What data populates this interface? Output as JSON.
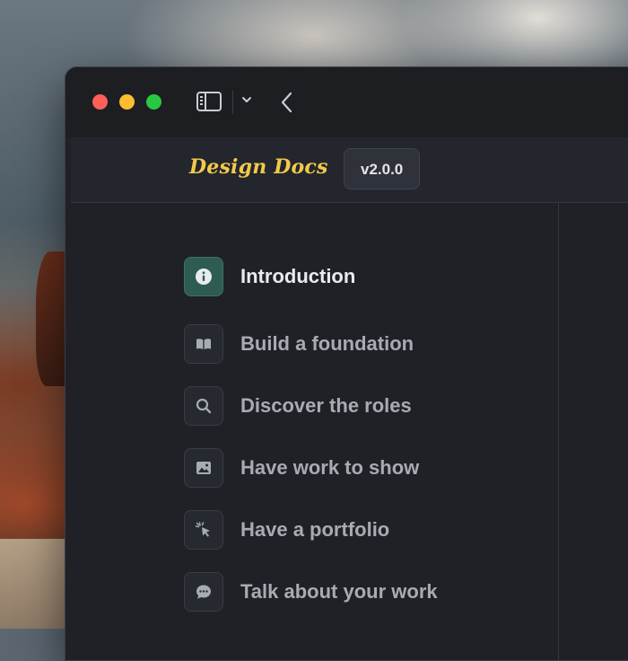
{
  "window": {
    "controls": [
      "close",
      "minimize",
      "maximize"
    ],
    "toolbar_icons": [
      "sidebar-icon",
      "chevron-down-icon",
      "chevron-left-icon"
    ]
  },
  "header": {
    "brand": "Design Docs",
    "version": "v2.0.0"
  },
  "colors": {
    "brand": "#f3c94b",
    "active_icon_bg": "#2e5b52",
    "window_bg": "#1f2126"
  },
  "nav": {
    "items": [
      {
        "label": "Introduction",
        "icon": "info-icon",
        "active": true
      },
      {
        "label": "Build a foundation",
        "icon": "book-icon",
        "active": false
      },
      {
        "label": "Discover the roles",
        "icon": "search-icon",
        "active": false
      },
      {
        "label": "Have work to show",
        "icon": "image-icon",
        "active": false
      },
      {
        "label": "Have a portfolio",
        "icon": "cursor-click-icon",
        "active": false
      },
      {
        "label": "Talk about your work",
        "icon": "chat-icon",
        "active": false
      }
    ]
  }
}
